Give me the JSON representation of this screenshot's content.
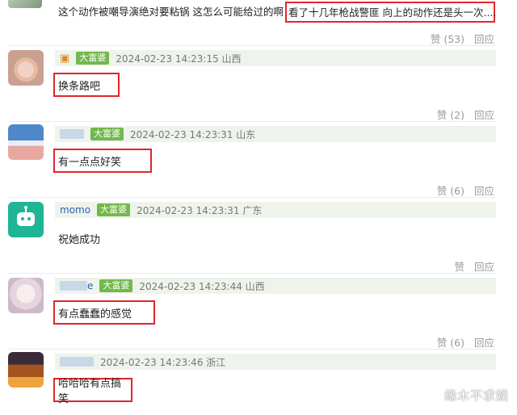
{
  "top": {
    "text": "这个动作被嘲导演绝对要粘锅 这怎么可能给过的啊",
    "highlight": "看了十几年枪战警匪 向上的动作还是头一次....",
    "like": "赞 (53)",
    "reply": "回应"
  },
  "comments": [
    {
      "avatar": "avatar-cat",
      "username": "",
      "badge": "大富婆",
      "time": "2024-02-23 14:23:15 山西",
      "body": "换条路吧",
      "like": "赞 (2)",
      "reply": "回应"
    },
    {
      "avatar": "avatar-mountain",
      "username": "",
      "badge": "大富婆",
      "time": "2024-02-23 14:23:31 山东",
      "body": "有一点点好笑",
      "like": "赞 (6)",
      "reply": "回应"
    },
    {
      "avatar": "avatar-robot",
      "username": "momo",
      "badge": "大富婆",
      "time": "2024-02-23 14:23:31 广东",
      "body": "祝她成功",
      "like": "赞",
      "reply": "回应"
    },
    {
      "avatar": "avatar-anime",
      "username": "e",
      "badge": "大富婆",
      "time": "2024-02-23 14:23:44 山西",
      "body": "有点蠢蠢的感觉",
      "like": "赞 (6)",
      "reply": "回应"
    },
    {
      "avatar": "avatar-game",
      "username": "",
      "badge": "",
      "time": "2024-02-23 14:23:46 浙江",
      "body": "哈哈哈有点搞笑",
      "like": "",
      "reply": ""
    }
  ],
  "watermark": "缘木不求娱",
  "colors": {
    "highlight_border": "#e0262b",
    "badge": "#73b84c",
    "meta_bg": "#eef4ec",
    "username": "#2a62b5"
  }
}
